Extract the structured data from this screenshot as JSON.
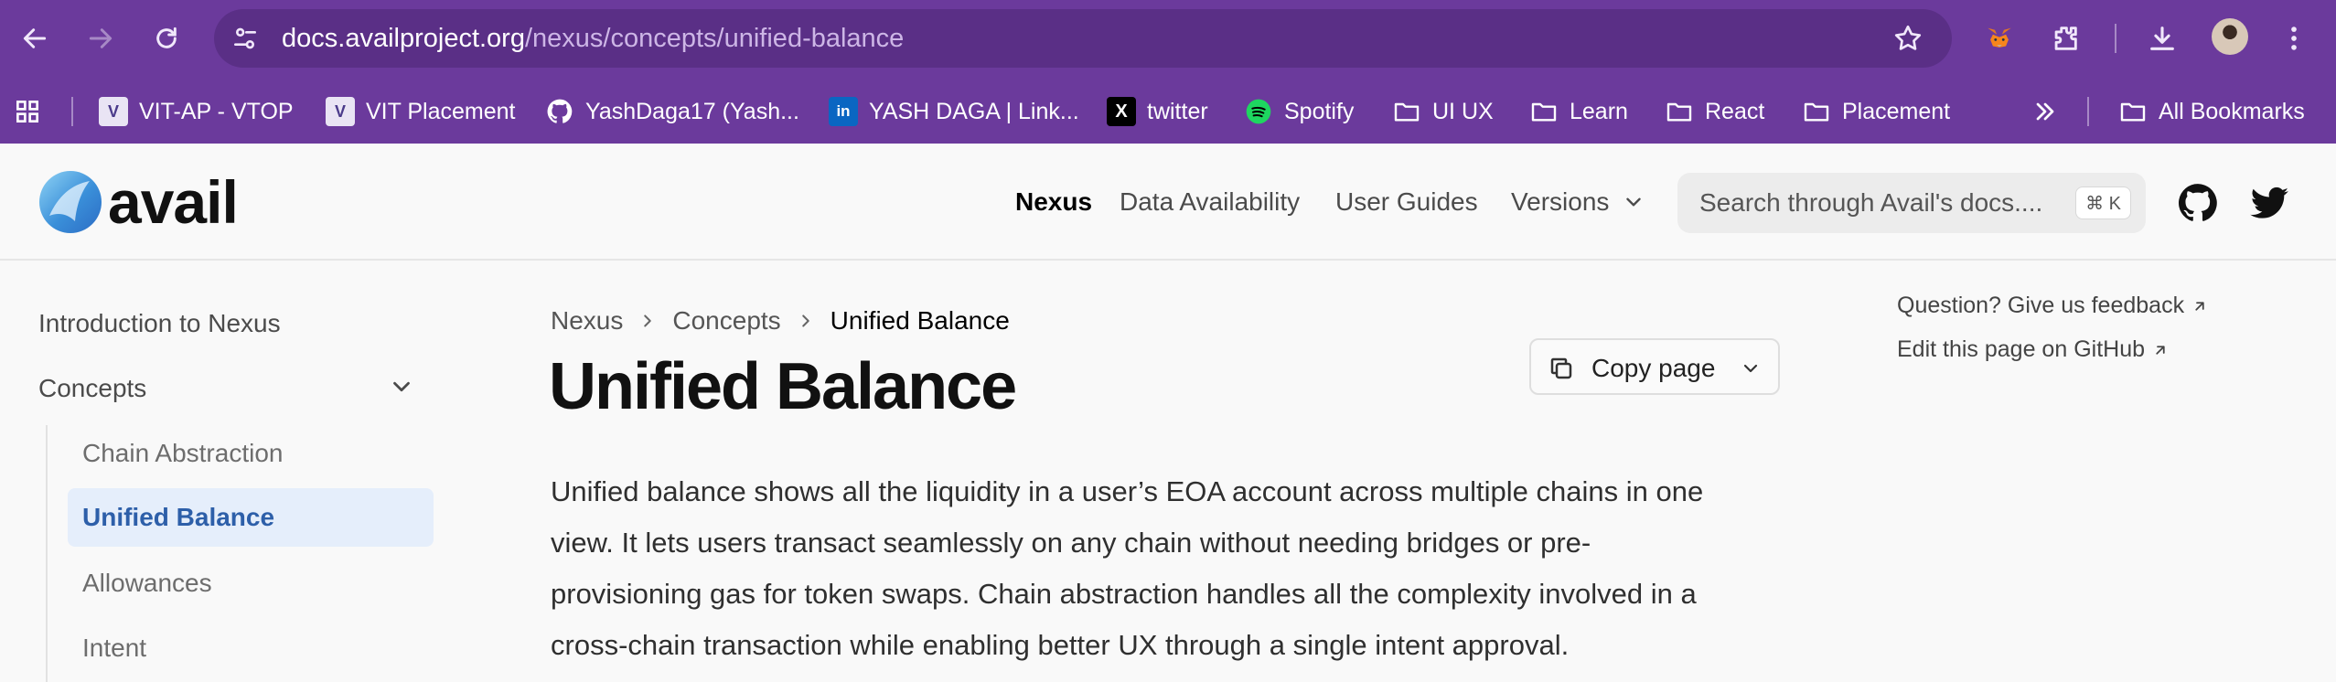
{
  "browser": {
    "url_host": "docs.availproject.org",
    "url_path": "/nexus/concepts/unified-balance",
    "icons": [
      "back-icon",
      "forward-icon",
      "reload-icon",
      "site-settings-icon",
      "bookmark-star-icon",
      "metamask-icon",
      "extensions-icon",
      "download-icon",
      "profile-avatar",
      "more-menu-icon"
    ],
    "bookmarks": [
      {
        "label": "VIT-AP - VTOP",
        "icon": "vit-favicon"
      },
      {
        "label": "VIT Placement",
        "icon": "vit-favicon"
      },
      {
        "label": "YashDaga17 (Yash...",
        "icon": "github-icon"
      },
      {
        "label": "YASH DAGA | Link...",
        "icon": "linkedin-icon"
      },
      {
        "label": "twitter",
        "icon": "x-icon"
      },
      {
        "label": "Spotify",
        "icon": "spotify-icon"
      },
      {
        "label": "UI UX",
        "icon": "folder-icon"
      },
      {
        "label": "Learn",
        "icon": "folder-icon"
      },
      {
        "label": "React",
        "icon": "folder-icon"
      },
      {
        "label": "Placement",
        "icon": "folder-icon"
      }
    ],
    "all_bookmarks": "All Bookmarks",
    "colors": {
      "chrome": "#6b3a9c",
      "omnibox": "#5a2f86"
    }
  },
  "site": {
    "logo_text": "avail",
    "nav": [
      "Nexus",
      "Data Availability",
      "User Guides",
      "Versions"
    ],
    "search_placeholder": "Search through Avail's docs....",
    "search_shortcut": "⌘ K",
    "icons": [
      "github-icon",
      "twitter-icon"
    ]
  },
  "sidebar": {
    "items": [
      "Introduction to Nexus",
      "Concepts"
    ],
    "subitems": [
      "Chain Abstraction",
      "Unified Balance",
      "Allowances",
      "Intent"
    ],
    "active": "Unified Balance",
    "accent": "#2d5fa9"
  },
  "main": {
    "breadcrumb": [
      "Nexus",
      "Concepts",
      "Unified Balance"
    ],
    "title": "Unified Balance",
    "copy_page": "Copy page",
    "paragraph_lines": [
      "Unified balance shows all the liquidity in a user’s EOA account across multiple chains in one",
      "view. It lets users transact seamlessly on any chain without needing bridges or pre-",
      "provisioning gas for token swaps. Chain abstraction handles all the complexity involved in a",
      "cross-chain transaction while enabling better UX through a single intent approval."
    ]
  },
  "aside": {
    "feedback": "Question? Give us feedback",
    "edit": "Edit this page on GitHub"
  }
}
